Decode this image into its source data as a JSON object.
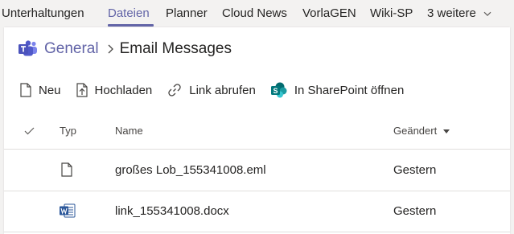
{
  "tabs": [
    {
      "label": "Unterhaltungen"
    },
    {
      "label": "Dateien",
      "active": true
    },
    {
      "label": "Planner"
    },
    {
      "label": "Cloud News"
    },
    {
      "label": "VorlaGEN"
    },
    {
      "label": "Wiki-SP"
    },
    {
      "label": "3 weitere"
    }
  ],
  "breadcrumb": {
    "root": "General",
    "current": "Email Messages"
  },
  "toolbar": {
    "new_label": "Neu",
    "upload_label": "Hochladen",
    "get_link_label": "Link abrufen",
    "open_sharepoint_label": "In SharePoint öffnen"
  },
  "table": {
    "headers": {
      "type": "Typ",
      "name": "Name",
      "modified": "Geändert"
    },
    "rows": [
      {
        "icon": "generic-file-icon",
        "name": "großes Lob_155341008.eml",
        "modified": "Gestern"
      },
      {
        "icon": "word-doc-icon",
        "name": "link_155341008.docx",
        "modified": "Gestern"
      }
    ]
  },
  "colors": {
    "accent": "#6264a7",
    "word": "#2b579a",
    "sharepoint": "#038387"
  }
}
